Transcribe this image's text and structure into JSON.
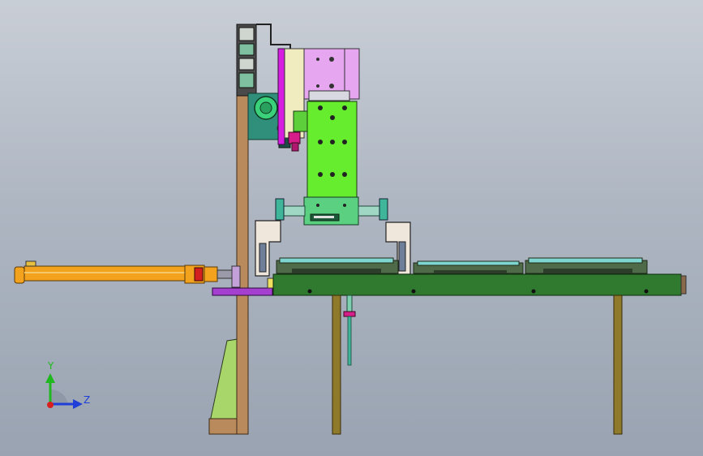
{
  "view": {
    "triad": {
      "y_label": "Y",
      "z_label": "Z",
      "y_color": "#1fb81f",
      "z_color": "#1f3fd8",
      "origin_color": "#d81f1f"
    }
  },
  "colors": {
    "background_top": "#c9ced6",
    "background_bottom": "#99a3b1",
    "column_brown": "#b98a5c",
    "base_green": "#a8d66a",
    "table_green": "#2f7a2f",
    "leg_olive": "#8f7a2c",
    "cylinder_orange": "#f2a21c",
    "slide_green": "#66ee2e",
    "cylinder_pink": "#e6a6f0",
    "magenta": "#d61ee0",
    "teal_plate": "#2f8f7a",
    "clamp_white": "#efe6dc",
    "rail_teal": "#3fb59a",
    "purple_block": "#a43fd0"
  },
  "components": [
    "vertical-column",
    "column-base-gusset",
    "horizontal-cylinder",
    "lift-cylinder",
    "slide-block",
    "gripper-bar",
    "left-clamp-jaw",
    "right-clamp-jaw",
    "worktable",
    "table-leg-left",
    "table-leg-right",
    "fixture-tray",
    "sensor-probe",
    "motor-bracket",
    "cable-carrier"
  ]
}
